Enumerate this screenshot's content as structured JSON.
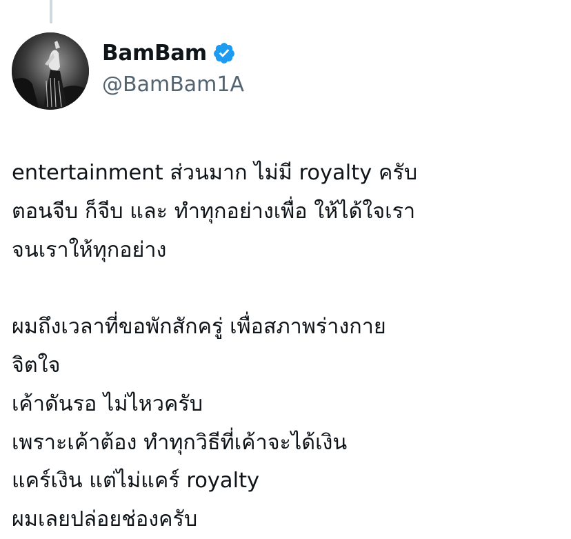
{
  "author": {
    "display_name": "BamBam",
    "handle": "@BamBam1A",
    "verified": true,
    "verified_icon": "verified-badge-icon",
    "verified_color": "#1d9bf0"
  },
  "tweet": {
    "paragraph1": [
      "entertainment ส่วนมาก ไม่มี royalty ครับ",
      "ตอนจีบ ก็จีบ และ ทำทุกอย่างเพื่อ ให้ได้ใจเรา",
      "จนเราให้ทุกอย่าง"
    ],
    "paragraph2": [
      "ผมถึงเวลาที่ขอพักสักครู่ เพื่อสภาพร่างกาย",
      "จิตใจ",
      "เค้าดันรอ ไม่ไหวครับ",
      "เพราะเค้าต้อง ทำทุกวิธีที่เค้าจะได้เงิน",
      "แคร์เงิน แต่ไม่แคร์ royalty",
      "ผมเลยปล่อยช่องครับ"
    ]
  },
  "colors": {
    "text": "#0f1419",
    "secondary_text": "#536471",
    "thread_line": "#cfd9de"
  }
}
